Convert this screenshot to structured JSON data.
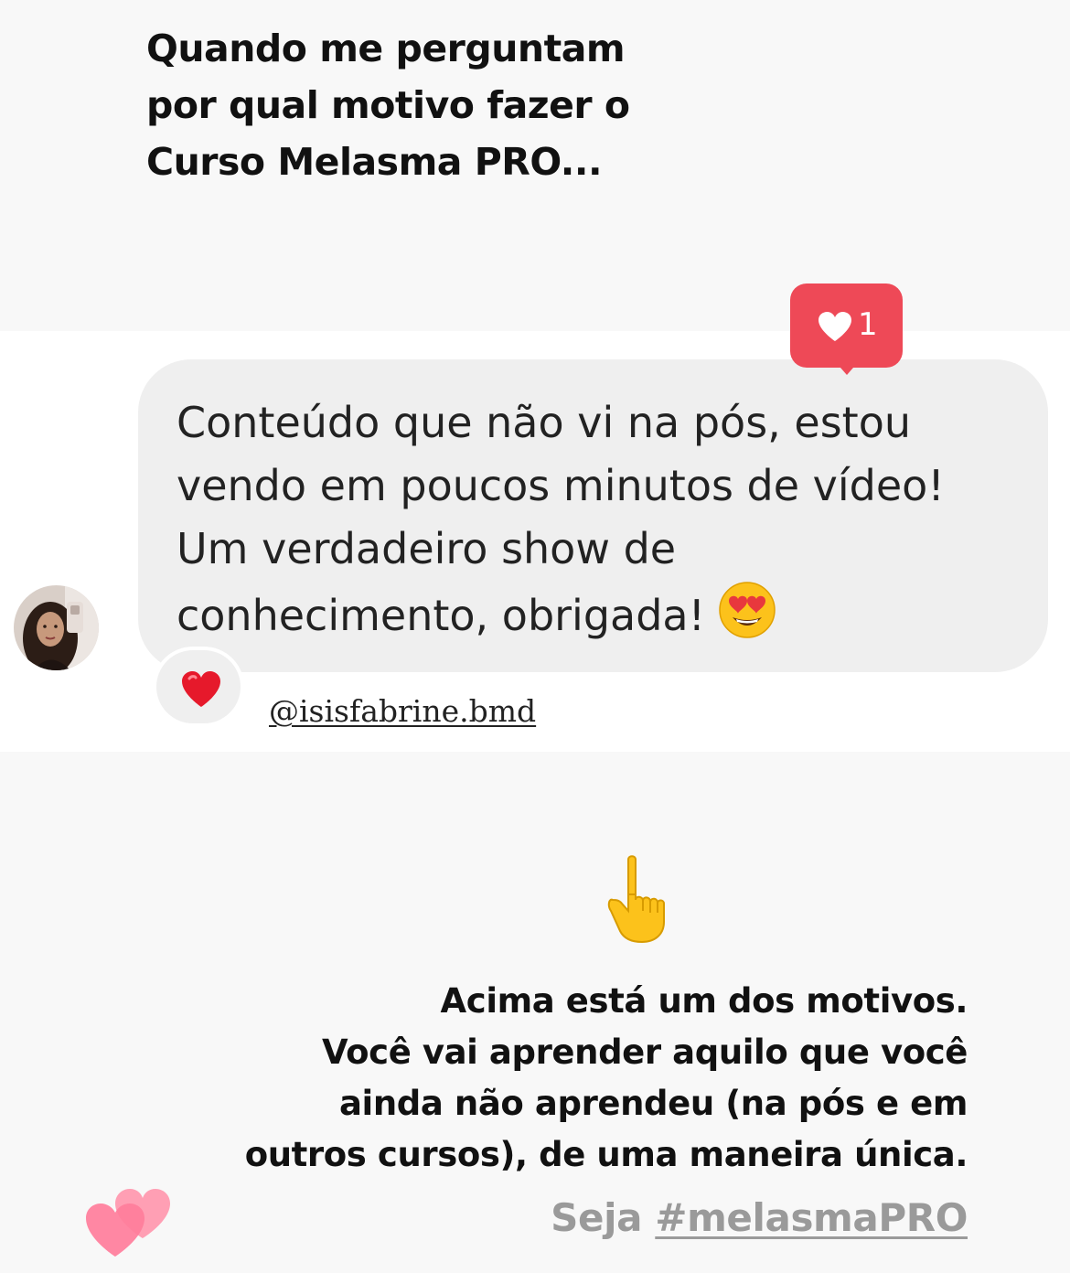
{
  "header": {
    "headline_lines": [
      "Quando me perguntam",
      "por qual motivo fazer o",
      "Curso Melasma PRO..."
    ]
  },
  "message": {
    "text_lines": [
      "Conteúdo que não vi na pós, estou",
      "vendo em poucos minutos de vídeo!",
      "Um verdadeiro show de",
      "conhecimento, obrigada!"
    ],
    "emoji": "heart-eyes-emoji",
    "like_count": "1",
    "reaction_icon": "red-heart-icon",
    "username": "@isisfabrine.bmd",
    "avatar": "profile-avatar"
  },
  "footer": {
    "pointing_icon": "pointing-up-emoji",
    "body_lines": [
      "Acima está um dos motivos.",
      "Você vai aprender aquilo que você",
      "ainda não aprendeu (na pós e em",
      "outros cursos), de uma maneira única."
    ],
    "hashtag_prefix": "Seja ",
    "hashtag": "#melasmaPRO",
    "sticker_icon": "pink-hearts-sticker"
  },
  "colors": {
    "background": "#f8f8f8",
    "bubble": "#efefef",
    "like_badge": "#ee4957",
    "hashtag_text": "#9a9a9a"
  }
}
